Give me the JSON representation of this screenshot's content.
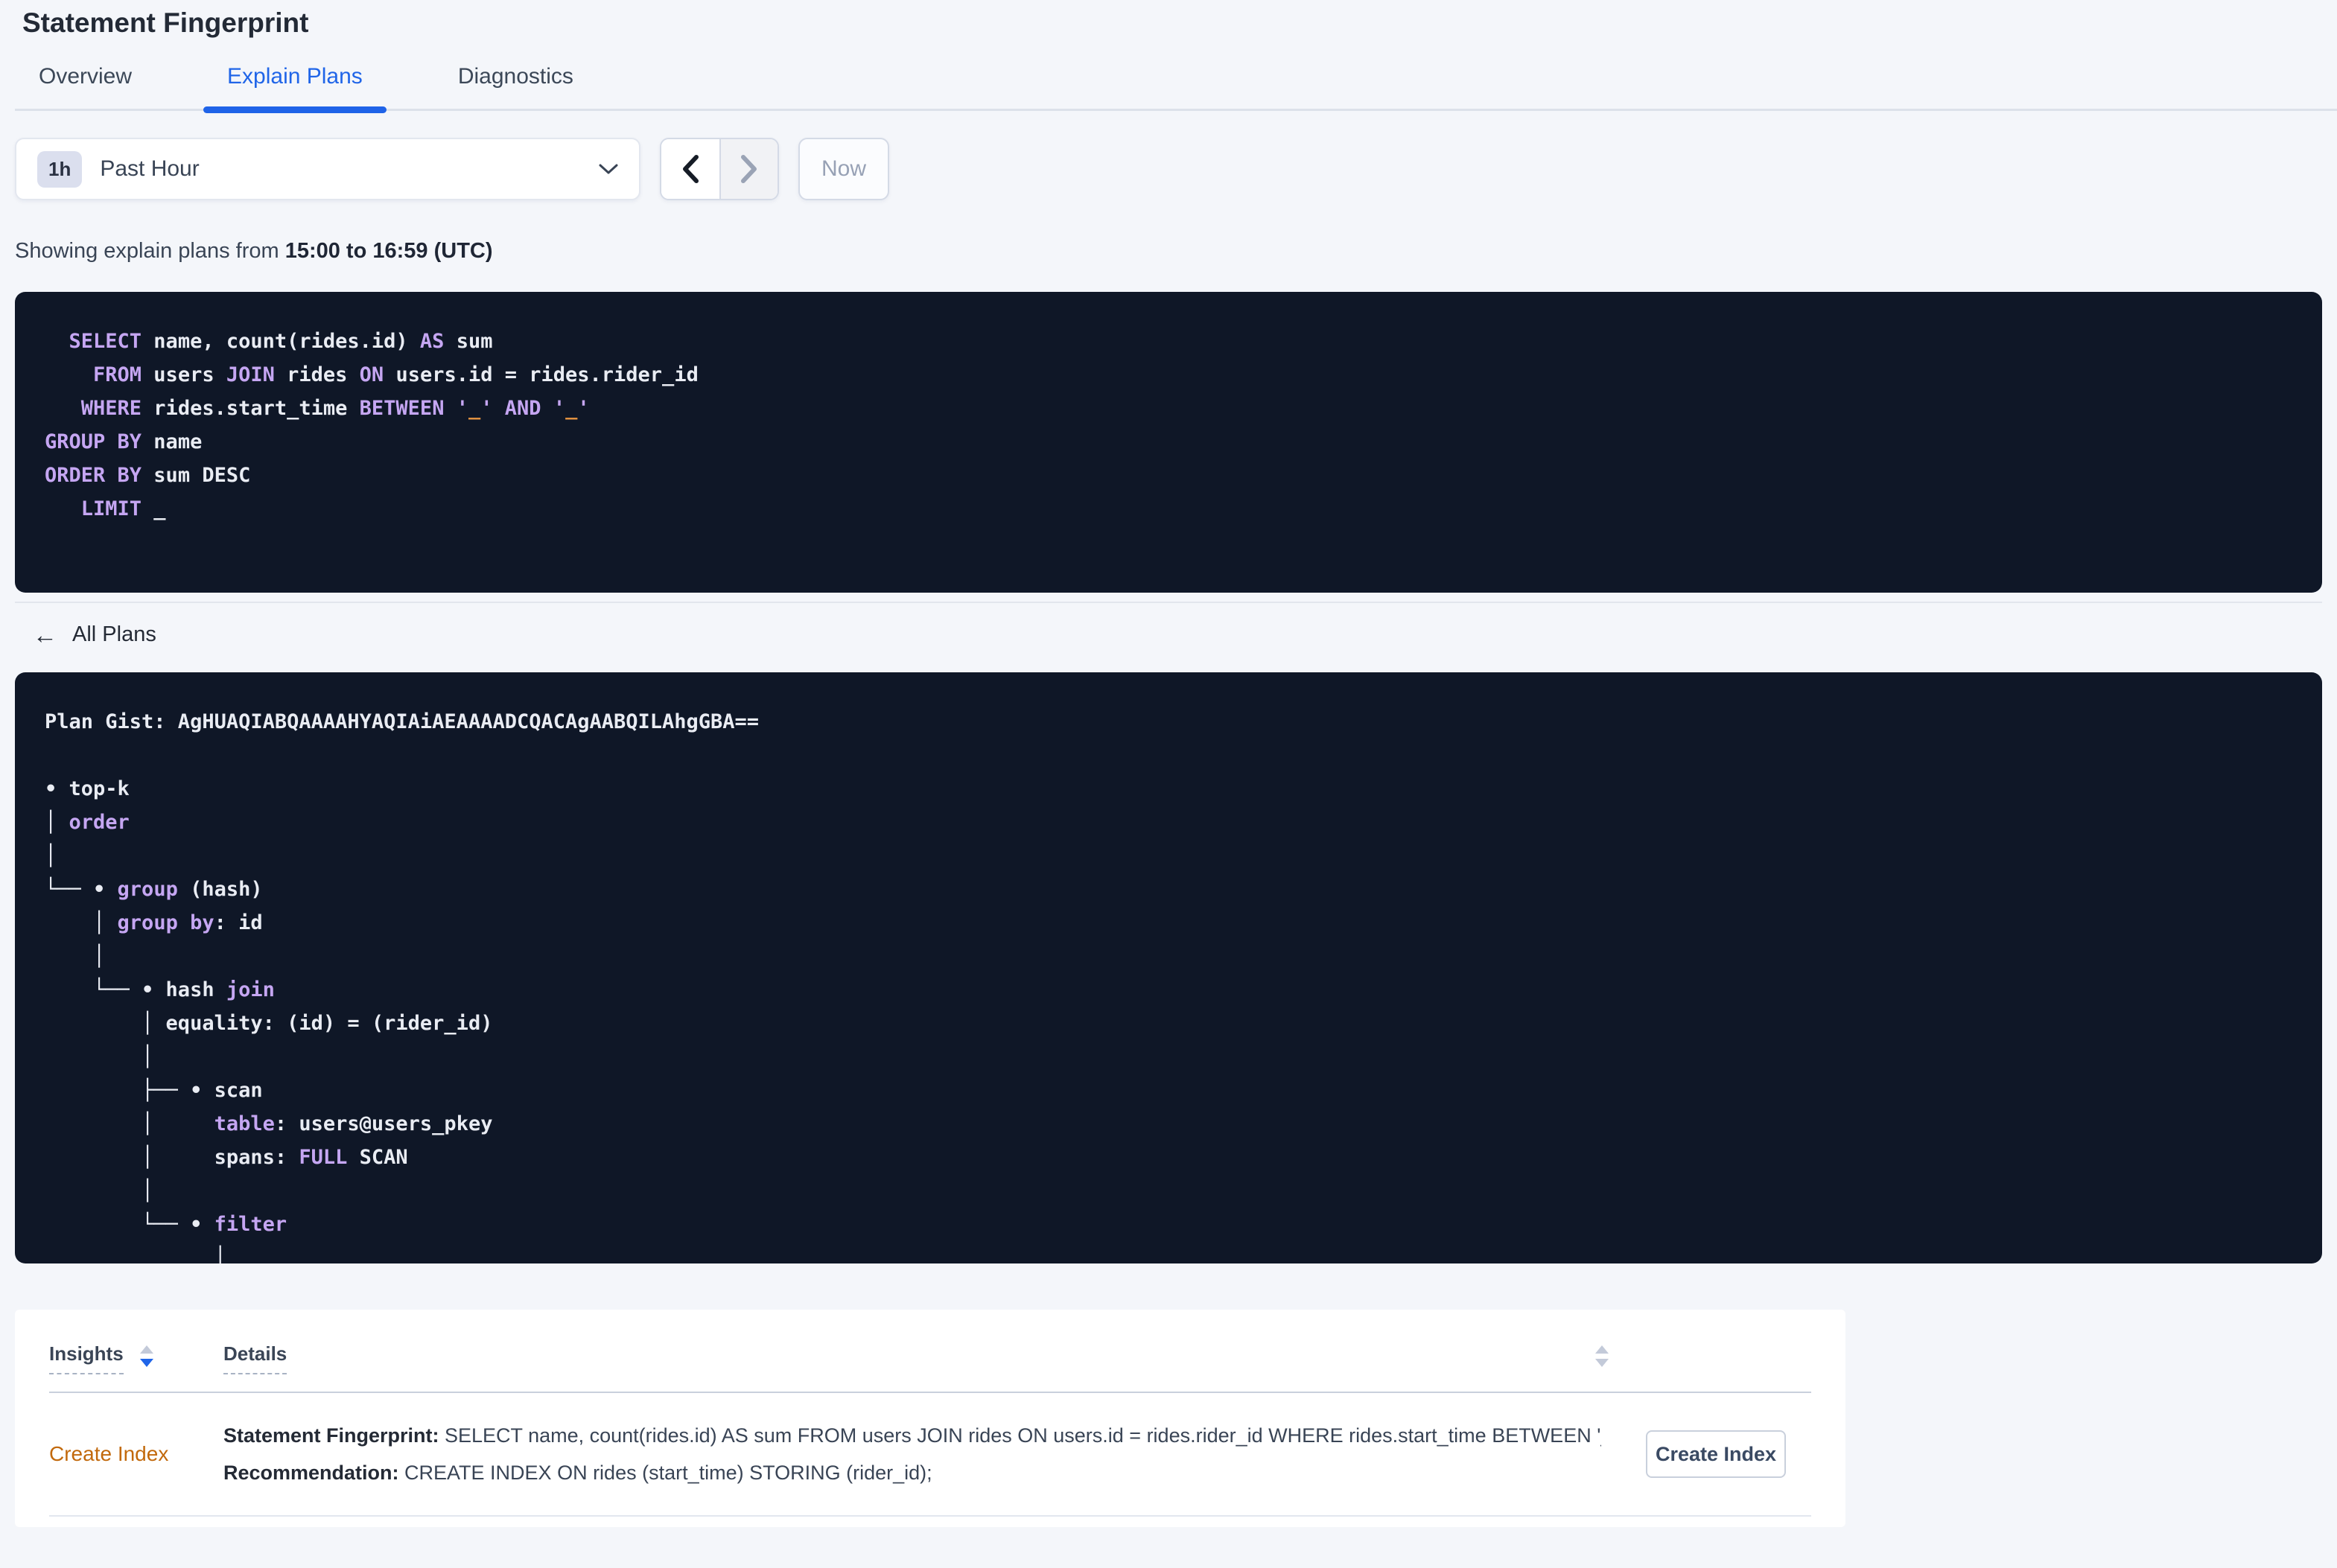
{
  "header": {
    "title": "Statement Fingerprint"
  },
  "tabs": [
    {
      "label": "Overview"
    },
    {
      "label": "Explain Plans"
    },
    {
      "label": "Diagnostics"
    }
  ],
  "active_tab": "Explain Plans",
  "time_picker": {
    "badge": "1h",
    "selected": "Past Hour"
  },
  "time_nav": {
    "now_label": "Now"
  },
  "summary": {
    "prefix": "Showing explain plans from ",
    "bold_range": "15:00 to 16:59 (UTC)"
  },
  "sql_box": {
    "lines": [
      [
        [
          "kw",
          "  SELECT"
        ],
        [
          "tx",
          " name, count(rides.id) "
        ],
        [
          "kw",
          "AS"
        ],
        [
          "tx",
          " sum"
        ]
      ],
      [
        [
          "kw",
          "    FROM"
        ],
        [
          "tx",
          " users "
        ],
        [
          "kw",
          "JOIN"
        ],
        [
          "tx",
          " rides "
        ],
        [
          "kw",
          "ON"
        ],
        [
          "tx",
          " users.id = rides.rider_id"
        ]
      ],
      [
        [
          "kw",
          "   WHERE"
        ],
        [
          "tx",
          " rides.start_time "
        ],
        [
          "kw",
          "BETWEEN"
        ],
        [
          "tx",
          " "
        ],
        [
          "q",
          "'"
        ],
        [
          "lit",
          "_"
        ],
        [
          "q",
          "'"
        ],
        [
          "tx",
          " "
        ],
        [
          "kw",
          "AND"
        ],
        [
          "tx",
          " "
        ],
        [
          "q",
          "'"
        ],
        [
          "lit",
          "_"
        ],
        [
          "q",
          "'"
        ]
      ],
      [
        [
          "kw",
          "GROUP BY"
        ],
        [
          "tx",
          " name"
        ]
      ],
      [
        [
          "kw",
          "ORDER BY"
        ],
        [
          "tx",
          " sum DESC"
        ]
      ],
      [
        [
          "kw",
          "   LIMIT"
        ],
        [
          "tx",
          " _"
        ]
      ]
    ]
  },
  "all_plans": {
    "arrow": "←",
    "label": "All Plans"
  },
  "plan_box": {
    "lines": [
      [
        [
          "tx",
          "Plan Gist: AgHUAQIABQAAAAHYAQIAiAEAAAADCQACAgAABQILAhgGBA=="
        ]
      ],
      [
        [
          "tx",
          ""
        ]
      ],
      [
        [
          "tx",
          "• top-k"
        ]
      ],
      [
        [
          "tx",
          "│ "
        ],
        [
          "kw",
          "order"
        ]
      ],
      [
        [
          "tx",
          "│"
        ]
      ],
      [
        [
          "tx",
          "└── • "
        ],
        [
          "kw",
          "group"
        ],
        [
          "tx",
          " (hash)"
        ]
      ],
      [
        [
          "tx",
          "    │ "
        ],
        [
          "kw",
          "group by"
        ],
        [
          "tx",
          ": id"
        ]
      ],
      [
        [
          "tx",
          "    │"
        ]
      ],
      [
        [
          "tx",
          "    └── • hash "
        ],
        [
          "kw",
          "join"
        ]
      ],
      [
        [
          "tx",
          "        │ equality: (id) = (rider_id)"
        ]
      ],
      [
        [
          "tx",
          "        │"
        ]
      ],
      [
        [
          "tx",
          "        ├── • scan"
        ]
      ],
      [
        [
          "tx",
          "        │     "
        ],
        [
          "kw",
          "table"
        ],
        [
          "tx",
          ": users@users_pkey"
        ]
      ],
      [
        [
          "tx",
          "        │     spans: "
        ],
        [
          "kw",
          "FULL"
        ],
        [
          "tx",
          " SCAN"
        ]
      ],
      [
        [
          "tx",
          "        │"
        ]
      ],
      [
        [
          "tx",
          "        └── • "
        ],
        [
          "kw",
          "filter"
        ]
      ],
      [
        [
          "tx",
          "              │"
        ]
      ]
    ]
  },
  "insights_table": {
    "col1": "Insights",
    "col2": "Details",
    "sort": "insights-descending",
    "row": {
      "insight_link": "Create Index",
      "line1_label": "Statement Fingerprint:",
      "line1_text": " SELECT name, count(rides.id) AS sum FROM users JOIN rides ON users.id = rides.rider_id WHERE rides.start_time BETWEEN '_…",
      "line2_label": "Recommendation:",
      "line2_text": " CREATE INDEX ON rides (start_time) STORING (rider_id);",
      "action_label": "Create Index"
    }
  },
  "colors": {
    "accent_blue": "#2065E8",
    "code_background": "#0F1727",
    "code_keyword": "#C5A6F2",
    "code_literal": "#E09140",
    "insight_link_orange": "#C2690C",
    "page_background": "#F4F6FA"
  }
}
